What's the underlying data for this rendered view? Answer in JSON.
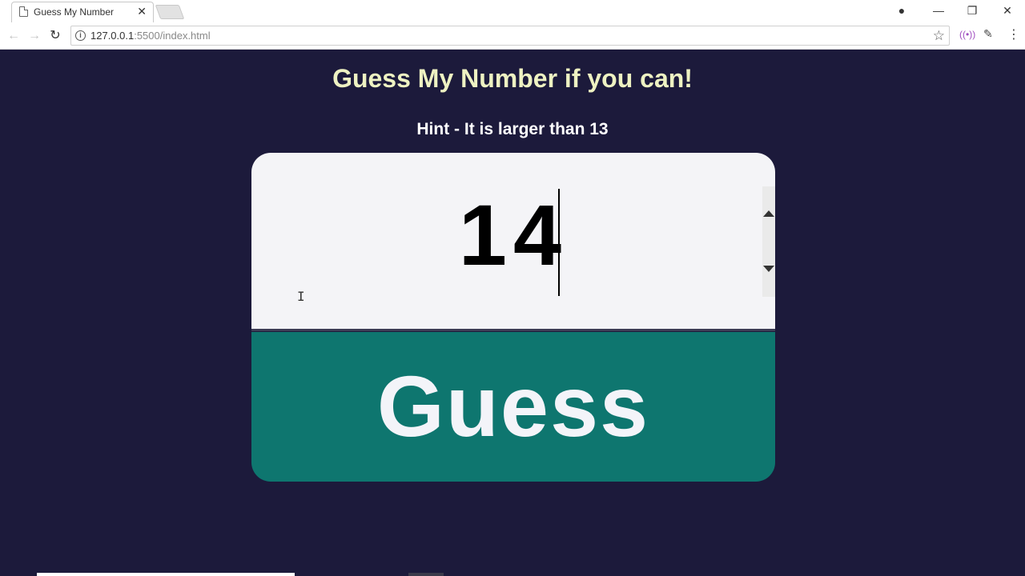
{
  "browser": {
    "tab_title": "Guess My Number",
    "tab_close": "✕",
    "url_main": "127.0.0.1",
    "url_rest": ":5500/index.html",
    "window_controls": {
      "account": "●",
      "minimize": "—",
      "restore": "❐",
      "close": "✕"
    }
  },
  "page": {
    "heading": "Guess My Number if you can!",
    "hint": "Hint - It is larger than 13",
    "guess_value": "14",
    "button_label": "Guess"
  },
  "colors": {
    "background": "#1c1a3b",
    "heading": "#eef2c2",
    "button": "#0e766f",
    "input_bg": "#f4f4f7"
  }
}
